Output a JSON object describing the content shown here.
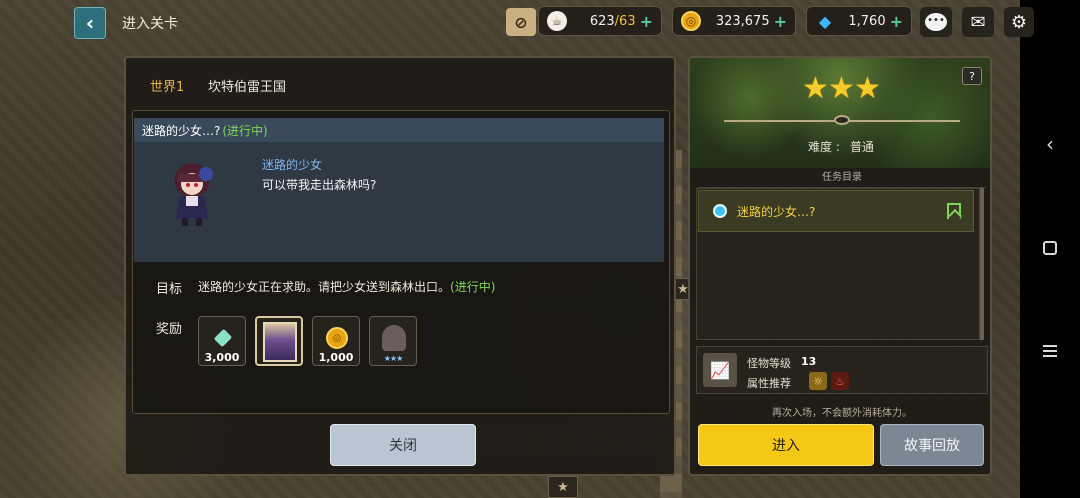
{
  "header": {
    "title": "进入关卡",
    "back_icon": "‹"
  },
  "resources": {
    "stamina": {
      "icon": "coffee-cup-icon",
      "current": "623",
      "max": "/63"
    },
    "gold": {
      "icon": "gold-coin-icon",
      "value": "323,675"
    },
    "gems": {
      "icon": "diamond-icon",
      "value": "1,760"
    },
    "plus": "+"
  },
  "world": {
    "tab": "世界1",
    "name": "坎特伯雷王国"
  },
  "quest": {
    "title": "迷路的少女…?",
    "status": "(进行中)",
    "npc_name": "迷路的少女",
    "npc_line": "可以带我走出森林吗?"
  },
  "goal": {
    "label": "目标",
    "text": "迷路的少女正在求助。请把少女送到森林出口。",
    "status": "(进行中)"
  },
  "rewards": {
    "label": "奖励",
    "items": [
      {
        "icon": "gem-icon",
        "qty": "3,000"
      },
      {
        "icon": "hero-card-icon",
        "qty": ""
      },
      {
        "icon": "gold-coin-icon",
        "qty": "1,000"
      },
      {
        "icon": "locked-hero-icon",
        "qty": "★★★"
      }
    ]
  },
  "close_label": "关闭",
  "stage": {
    "help": "?",
    "stars": [
      "★",
      "★",
      "★"
    ],
    "difficulty_label": "难度 :",
    "difficulty_value": "普通",
    "task_list_title": "任务目录",
    "task_item": "迷路的少女…?",
    "monster_level_label": "怪物等级",
    "monster_level": "13",
    "attribute_label": "属性推荐",
    "attribute_icons": [
      "light-element-icon",
      "fire-element-icon"
    ],
    "reentry_note": "再次入场，不会额外消耗体力。",
    "enter_label": "进入",
    "replay_label": "故事回放"
  },
  "map": {
    "stage_stars": "★★★"
  },
  "colors": {
    "accent_yellow": "#f5c818",
    "progress_green": "#7ed957",
    "quest_blue": "#7fb7f0"
  }
}
